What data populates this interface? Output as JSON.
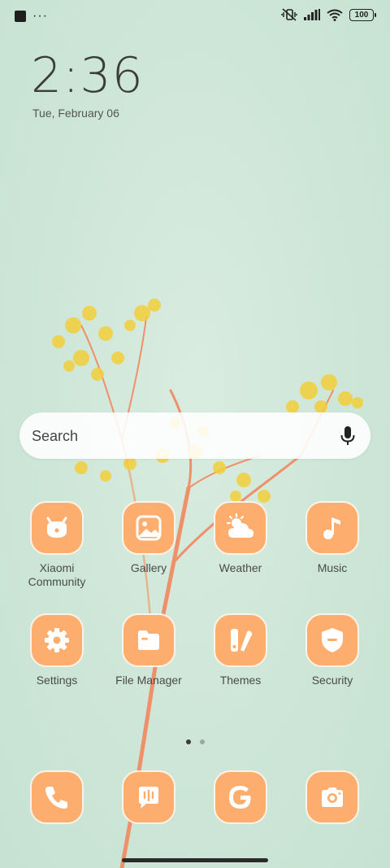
{
  "status_bar": {
    "icons": [
      "notification-square-icon",
      "more-dots-icon",
      "vibrate-off-icon",
      "signal-icon",
      "wifi-icon",
      "battery-icon"
    ],
    "more_indicator": "···",
    "battery_level": "100"
  },
  "clock": {
    "time": "2:36",
    "date": "Tue, February 06"
  },
  "search": {
    "placeholder": "Search",
    "icon": "mic-icon"
  },
  "apps": [
    {
      "label": "Xiaomi\nCommunity",
      "icon": "xiaomi-community-icon"
    },
    {
      "label": "Gallery",
      "icon": "gallery-icon"
    },
    {
      "label": "Weather",
      "icon": "weather-icon"
    },
    {
      "label": "Music",
      "icon": "music-icon"
    },
    {
      "label": "Settings",
      "icon": "settings-icon"
    },
    {
      "label": "File Manager",
      "icon": "file-manager-icon"
    },
    {
      "label": "Themes",
      "icon": "themes-icon"
    },
    {
      "label": "Security",
      "icon": "security-icon"
    }
  ],
  "dock": [
    {
      "icon": "phone-icon"
    },
    {
      "icon": "messages-icon"
    },
    {
      "icon": "google-icon"
    },
    {
      "icon": "camera-icon"
    }
  ],
  "page_indicator": {
    "pages": 2,
    "current": 1
  },
  "colors": {
    "icon_bg": "#fdae6f",
    "wallpaper": "#cde6d7",
    "flower": "#f3cf3a",
    "stem": "#f08a5a"
  }
}
